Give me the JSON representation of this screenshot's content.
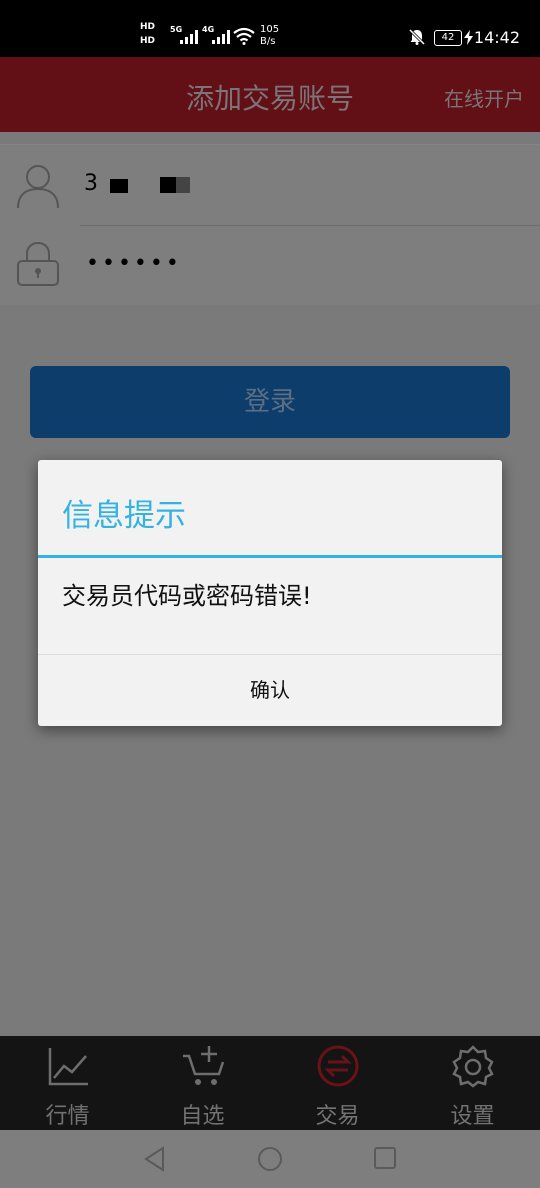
{
  "status_bar": {
    "sim1": "HD",
    "sim2": "HD",
    "net1": "5G",
    "net2": "4G",
    "speed_value": "105",
    "speed_unit": "B/s",
    "battery": "42",
    "time": "14:42"
  },
  "header": {
    "title": "添加交易账号",
    "right_link": "在线开户"
  },
  "form": {
    "username_value": "3",
    "password_value": "••••••"
  },
  "login_button_label": "登录",
  "dialog": {
    "title": "信息提示",
    "message": "交易员代码或密码错误!",
    "confirm_label": "确认"
  },
  "tabs": [
    {
      "label": "行情",
      "icon": "market-chart-icon"
    },
    {
      "label": "自选",
      "icon": "cart-add-icon"
    },
    {
      "label": "交易",
      "icon": "exchange-icon"
    },
    {
      "label": "设置",
      "icon": "gear-icon"
    }
  ],
  "active_tab": "交易",
  "colors": {
    "header": "#621015",
    "dialog_accent": "#34b2e2",
    "active_tab": "#6a1217",
    "button": "#0c3d6b"
  }
}
